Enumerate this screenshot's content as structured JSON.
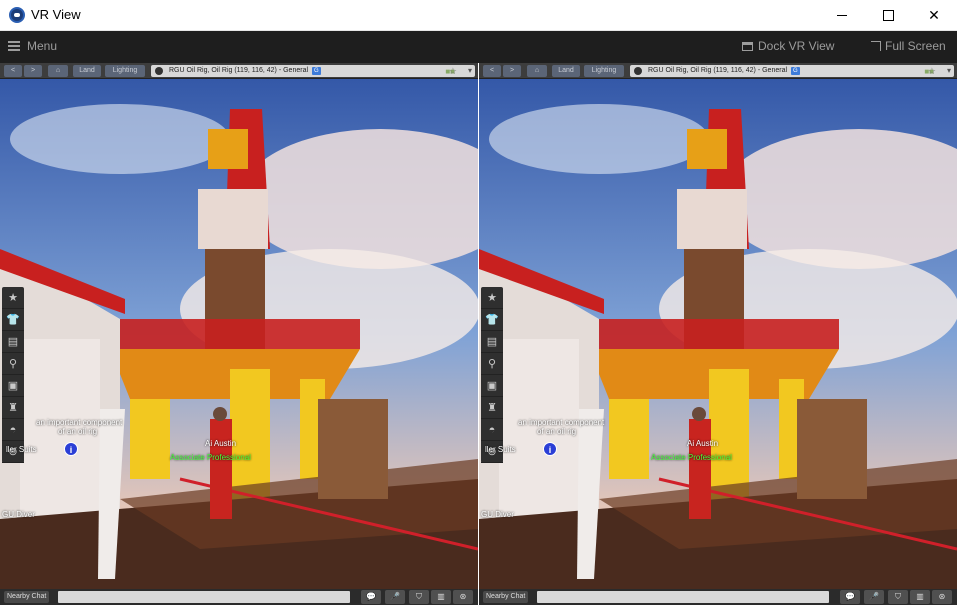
{
  "window": {
    "title": "VR View",
    "app_icon": "vr-icon",
    "minimize_icon": "minimize-icon",
    "maximize_icon": "maximize-icon",
    "close_symbol": "✕"
  },
  "menubar": {
    "menu_label": "Menu",
    "dock_label": "Dock VR View",
    "fullscreen_label": "Full Screen"
  },
  "viewer": {
    "nav": {
      "back": "<",
      "forward": ">",
      "home": "⌂",
      "land": "Land",
      "lighting": "Lighting",
      "location": "RGU Oil Rig, Oil Rig (119, 116, 42) - General",
      "maturity_badge": "G",
      "favorite": "☆",
      "dropdown": "▾"
    },
    "toolbar": [
      {
        "icon": "star-icon",
        "glyph": "★"
      },
      {
        "icon": "shirt-icon",
        "glyph": "👕"
      },
      {
        "icon": "inventory-icon",
        "glyph": "▤"
      },
      {
        "icon": "search-icon",
        "glyph": "⚲"
      },
      {
        "icon": "snapshot-icon",
        "glyph": "▣"
      },
      {
        "icon": "avatar-icon",
        "glyph": "♜"
      },
      {
        "icon": "map-icon",
        "glyph": "◓"
      },
      {
        "icon": "world-icon",
        "glyph": "⊛"
      }
    ],
    "labels": {
      "avatar_name": "Ai Austin",
      "group_title": "Associate Professional",
      "sign_line1": "an important component",
      "sign_line2": "of an oil rig",
      "sign_suits": "ller Suits",
      "sign_diver": "GU Diver"
    },
    "bottom": {
      "chat_label": "Nearby Chat",
      "buttons": [
        {
          "icon": "speech-icon",
          "glyph": "💬"
        },
        {
          "icon": "voice-icon",
          "glyph": "🎤"
        },
        {
          "icon": "gesture-icon",
          "glyph": "⛉"
        },
        {
          "icon": "map-icon",
          "glyph": "▥"
        },
        {
          "icon": "world-icon",
          "glyph": "⊛"
        }
      ]
    }
  },
  "colors": {
    "menubar_bg": "#1e1e1e",
    "sky_top": "#3d64b3",
    "derrick_red": "#c8201f",
    "derrick_yellow": "#f2c820",
    "name_green": "#43ff3a"
  }
}
